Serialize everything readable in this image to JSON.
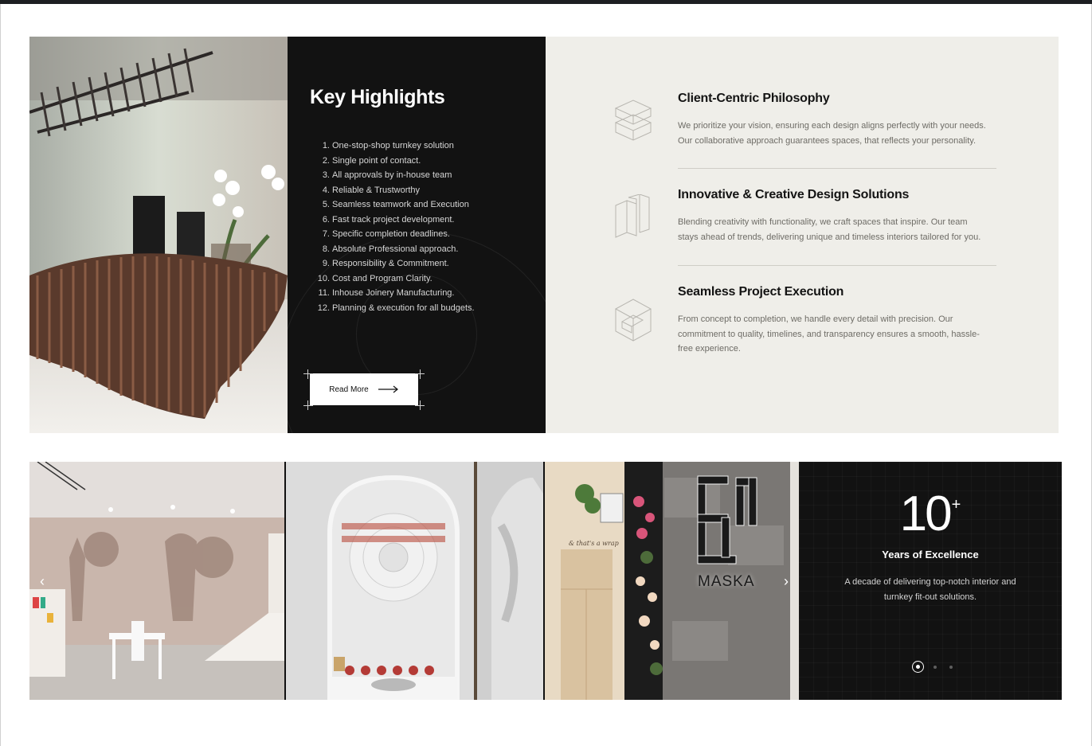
{
  "highlights": {
    "title": "Key Highlights",
    "items": [
      {
        "num": "1.",
        "text": "One-stop-shop turnkey solution"
      },
      {
        "num": "2.",
        "text": "Single point of contact."
      },
      {
        "num": "3.",
        "text": "All approvals by in-house team"
      },
      {
        "num": "4.",
        "text": "Reliable & Trustworthy"
      },
      {
        "num": "5.",
        "text": "Seamless teamwork and Execution"
      },
      {
        "num": "6.",
        "text": "Fast track project development."
      },
      {
        "num": "7.",
        "text": "Specific completion deadlines."
      },
      {
        "num": "8.",
        "text": "Absolute Professional approach."
      },
      {
        "num": "9.",
        "text": "Responsibility & Commitment."
      },
      {
        "num": "10.",
        "text": "Cost and Program Clarity."
      },
      {
        "num": "11.",
        "text": "Inhouse Joinery Manufacturing."
      },
      {
        "num": "12.",
        "text": "Planning & execution for all budgets."
      }
    ],
    "read_more_label": "Read More"
  },
  "features": [
    {
      "title": "Client-Centric Philosophy",
      "line1": "We prioritize your vision, ensuring each design aligns perfectly with your needs.",
      "line2": "Our collaborative approach guarantees spaces, that reflects your personality.",
      "icon": "stacked-boxes-icon"
    },
    {
      "title": "Innovative & Creative Design Solutions",
      "line1": "Blending creativity with functionality, we craft spaces that inspire. Our team",
      "line2": "stays ahead of trends, delivering unique and timeless interiors tailored for you.",
      "icon": "panels-icon"
    },
    {
      "title": "Seamless Project Execution",
      "line1": "From concept to completion, we handle every detail with precision. Our",
      "line2": "commitment to quality, timelines, and transparency ensures a smooth, hassle-",
      "line3": "free experience.",
      "icon": "cube-icon"
    }
  ],
  "gallery": {
    "prev_icon": "chevron-left-icon",
    "next_icon": "chevron-right-icon",
    "prev_glyph": "‹",
    "next_glyph": "›",
    "wall_text": "& that's a wrap",
    "sign_text": "MASKA"
  },
  "stats": {
    "number": "10",
    "suffix": "+",
    "label": "Years of Excellence",
    "description": "A decade of delivering top-notch interior and turnkey fit-out solutions.",
    "active_slide": 1,
    "slide_count": 3
  },
  "colors": {
    "dark_panel": "#121212",
    "features_bg": "#efeee9",
    "text_dark": "#141414",
    "text_muted": "#6e6c66"
  }
}
